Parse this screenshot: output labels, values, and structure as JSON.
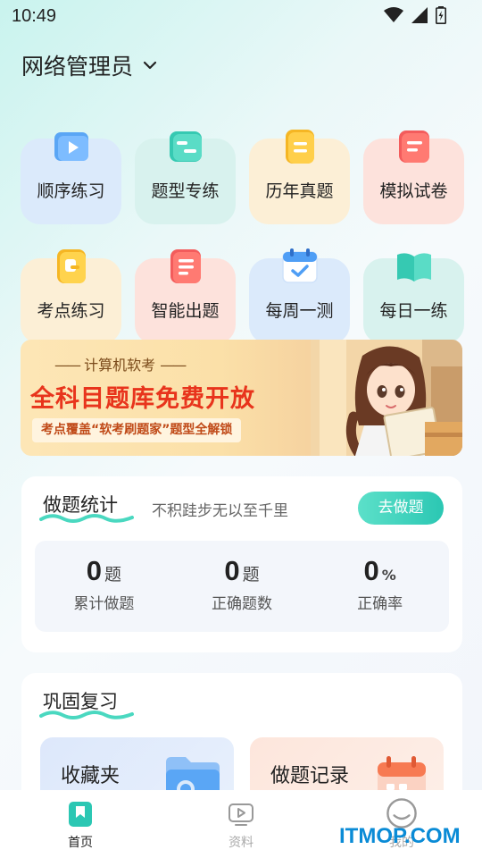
{
  "status": {
    "time": "10:49"
  },
  "header": {
    "title": "网络管理员"
  },
  "grid": [
    {
      "label": "顺序练习",
      "icon": "video-play-icon",
      "bg": "#dbeafb"
    },
    {
      "label": "题型专练",
      "icon": "toggle-card-icon",
      "bg": "#d8f2ee"
    },
    {
      "label": "历年真题",
      "icon": "document-icon",
      "bg": "#fcefd6"
    },
    {
      "label": "模拟试卷",
      "icon": "exam-paper-icon",
      "bg": "#fde2dc"
    },
    {
      "label": "考点练习",
      "icon": "notebook-icon",
      "bg": "#fcefd6"
    },
    {
      "label": "智能出题",
      "icon": "smart-list-icon",
      "bg": "#fde2dc"
    },
    {
      "label": "每周一测",
      "icon": "calendar-check-icon",
      "bg": "#dbeafb"
    },
    {
      "label": "每日一练",
      "icon": "open-book-icon",
      "bg": "#d8f2ee"
    }
  ],
  "banner": {
    "subtitle": "计算机软考",
    "title": "全科目题库免费开放",
    "tag": "考点覆盖“软考刷题家”题型全解锁"
  },
  "stats": {
    "title": "做题统计",
    "motto": "不积跬步无以至千里",
    "go_button": "去做题",
    "items": [
      {
        "value": "0",
        "unit": "题",
        "caption": "累计做题"
      },
      {
        "value": "0",
        "unit": "题",
        "caption": "正确题数"
      },
      {
        "value": "0",
        "unit": "%",
        "caption": "正确率"
      }
    ]
  },
  "review": {
    "title": "巩固复习",
    "favorites": "收藏夹",
    "records": "做题记录"
  },
  "tabbar": {
    "items": [
      {
        "label": "首页",
        "active": true
      },
      {
        "label": "资料",
        "active": false
      },
      {
        "label": "我的",
        "active": false
      }
    ]
  },
  "watermark": "ITMOP.COM",
  "colors": {
    "accent": "#2bc7b3",
    "banner_red": "#e8341c"
  }
}
